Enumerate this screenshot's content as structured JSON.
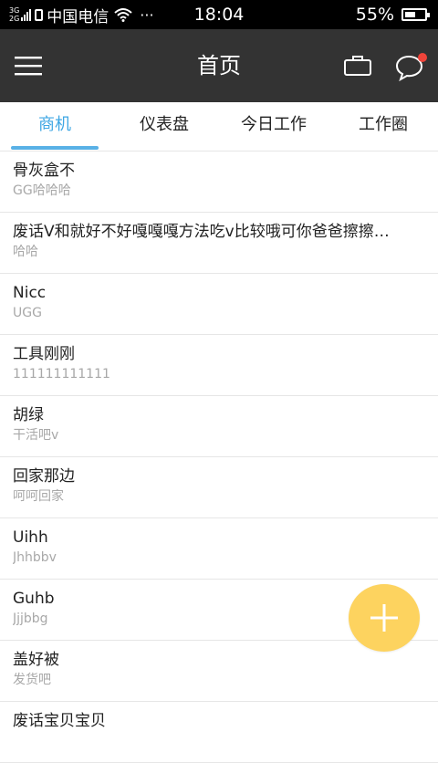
{
  "status_bar": {
    "net_top": "3G",
    "net_bottom": "2G",
    "carrier": "中国电信",
    "more": "···",
    "time": "18:04",
    "battery_percent": "55%",
    "battery_level": 0.55
  },
  "app_bar": {
    "title": "首页",
    "icons": [
      "menu-icon",
      "briefcase-icon",
      "chat-icon"
    ],
    "notification_dot_color": "#f0443a"
  },
  "tabs": [
    {
      "label": "商机",
      "active": true
    },
    {
      "label": "仪表盘",
      "active": false
    },
    {
      "label": "今日工作",
      "active": false
    },
    {
      "label": "工作圈",
      "active": false
    }
  ],
  "list": [
    {
      "title": "骨灰盒不",
      "subtitle": "GG哈哈哈"
    },
    {
      "title": "废话V和就好不好嘎嘎嘎方法吃v比较哦可你爸爸擦擦…",
      "subtitle": "哈哈"
    },
    {
      "title": "Nicc",
      "subtitle": "UGG"
    },
    {
      "title": "工具刚刚",
      "subtitle": "111111111111"
    },
    {
      "title": "胡绿",
      "subtitle": "干活吧v"
    },
    {
      "title": "回家那边",
      "subtitle": "呵呵回家"
    },
    {
      "title": "Uihh",
      "subtitle": "Jhhbbv"
    },
    {
      "title": "Guhb",
      "subtitle": "Jjjbbg"
    },
    {
      "title": "盖好被",
      "subtitle": "发货吧"
    },
    {
      "title": "废话宝贝宝贝",
      "subtitle": ""
    }
  ],
  "fab": {
    "icon": "plus-icon",
    "color": "#fdd35f"
  },
  "colors": {
    "app_bar": "#333333",
    "accent": "#3fa7e4",
    "subtitle": "#a8a8a8"
  }
}
